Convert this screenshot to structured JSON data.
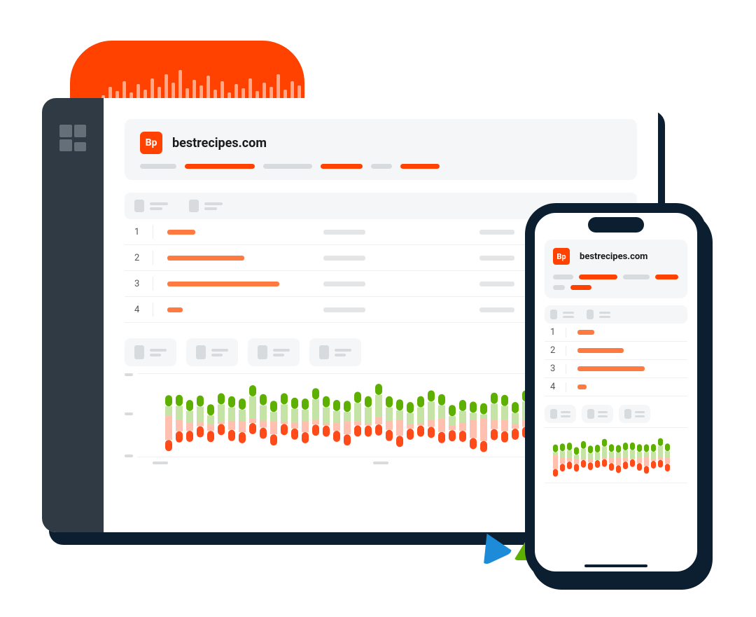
{
  "site": {
    "badge": "Bp",
    "name": "bestrecipes.com",
    "accent": "#ff4200"
  },
  "filters": {
    "items": [
      {
        "width": 52,
        "active": false
      },
      {
        "width": 100,
        "active": true
      },
      {
        "width": 70,
        "active": false
      },
      {
        "width": 60,
        "active": true
      },
      {
        "width": 30,
        "active": false
      },
      {
        "width": 56,
        "active": true
      }
    ]
  },
  "table": {
    "rows": [
      {
        "num": "1",
        "barWidth": 40
      },
      {
        "num": "2",
        "barWidth": 110
      },
      {
        "num": "3",
        "barWidth": 160
      },
      {
        "num": "4",
        "barWidth": 22
      }
    ]
  },
  "chart_data": {
    "type": "bar",
    "title": "",
    "xlabel": "",
    "ylabel": "",
    "ylim": [
      -35,
      35
    ],
    "series_desktop": [
      {
        "pos": 18,
        "neg": 32
      },
      {
        "pos": 22,
        "neg": 20
      },
      {
        "pos": 20,
        "neg": 18
      },
      {
        "pos": 24,
        "neg": 14
      },
      {
        "pos": 18,
        "neg": 16
      },
      {
        "pos": 26,
        "neg": 12
      },
      {
        "pos": 22,
        "neg": 18
      },
      {
        "pos": 20,
        "neg": 20
      },
      {
        "pos": 30,
        "neg": 14
      },
      {
        "pos": 24,
        "neg": 16
      },
      {
        "pos": 18,
        "neg": 22
      },
      {
        "pos": 26,
        "neg": 12
      },
      {
        "pos": 22,
        "neg": 16
      },
      {
        "pos": 20,
        "neg": 20
      },
      {
        "pos": 28,
        "neg": 14
      },
      {
        "pos": 24,
        "neg": 12
      },
      {
        "pos": 20,
        "neg": 18
      },
      {
        "pos": 18,
        "neg": 22
      },
      {
        "pos": 26,
        "neg": 14
      },
      {
        "pos": 24,
        "neg": 12
      },
      {
        "pos": 30,
        "neg": 16
      },
      {
        "pos": 22,
        "neg": 18
      },
      {
        "pos": 18,
        "neg": 24
      },
      {
        "pos": 20,
        "neg": 14
      },
      {
        "pos": 24,
        "neg": 12
      },
      {
        "pos": 26,
        "neg": 16
      },
      {
        "pos": 22,
        "neg": 22
      },
      {
        "pos": 18,
        "neg": 14
      },
      {
        "pos": 20,
        "neg": 18
      },
      {
        "pos": 16,
        "neg": 26
      },
      {
        "pos": 14,
        "neg": 30
      },
      {
        "pos": 24,
        "neg": 18
      },
      {
        "pos": 22,
        "neg": 20
      },
      {
        "pos": 20,
        "neg": 14
      },
      {
        "pos": 26,
        "neg": 16
      }
    ],
    "series_mobile": [
      {
        "pos": 14,
        "neg": 28
      },
      {
        "pos": 18,
        "neg": 18
      },
      {
        "pos": 20,
        "neg": 14
      },
      {
        "pos": 16,
        "neg": 16
      },
      {
        "pos": 22,
        "neg": 12
      },
      {
        "pos": 18,
        "neg": 14
      },
      {
        "pos": 20,
        "neg": 10
      },
      {
        "pos": 24,
        "neg": 12
      },
      {
        "pos": 18,
        "neg": 16
      },
      {
        "pos": 16,
        "neg": 20
      },
      {
        "pos": 20,
        "neg": 14
      },
      {
        "pos": 22,
        "neg": 10
      },
      {
        "pos": 18,
        "neg": 16
      },
      {
        "pos": 16,
        "neg": 22
      },
      {
        "pos": 20,
        "neg": 12
      },
      {
        "pos": 24,
        "neg": 14
      },
      {
        "pos": 18,
        "neg": 18
      }
    ]
  },
  "waveform_heights": [
    10,
    22,
    16,
    30,
    14,
    26,
    18,
    34,
    22,
    40,
    28,
    46,
    20,
    32,
    24,
    38,
    18,
    30,
    14,
    26,
    20,
    34,
    16,
    28,
    22,
    40,
    18,
    30,
    24
  ]
}
